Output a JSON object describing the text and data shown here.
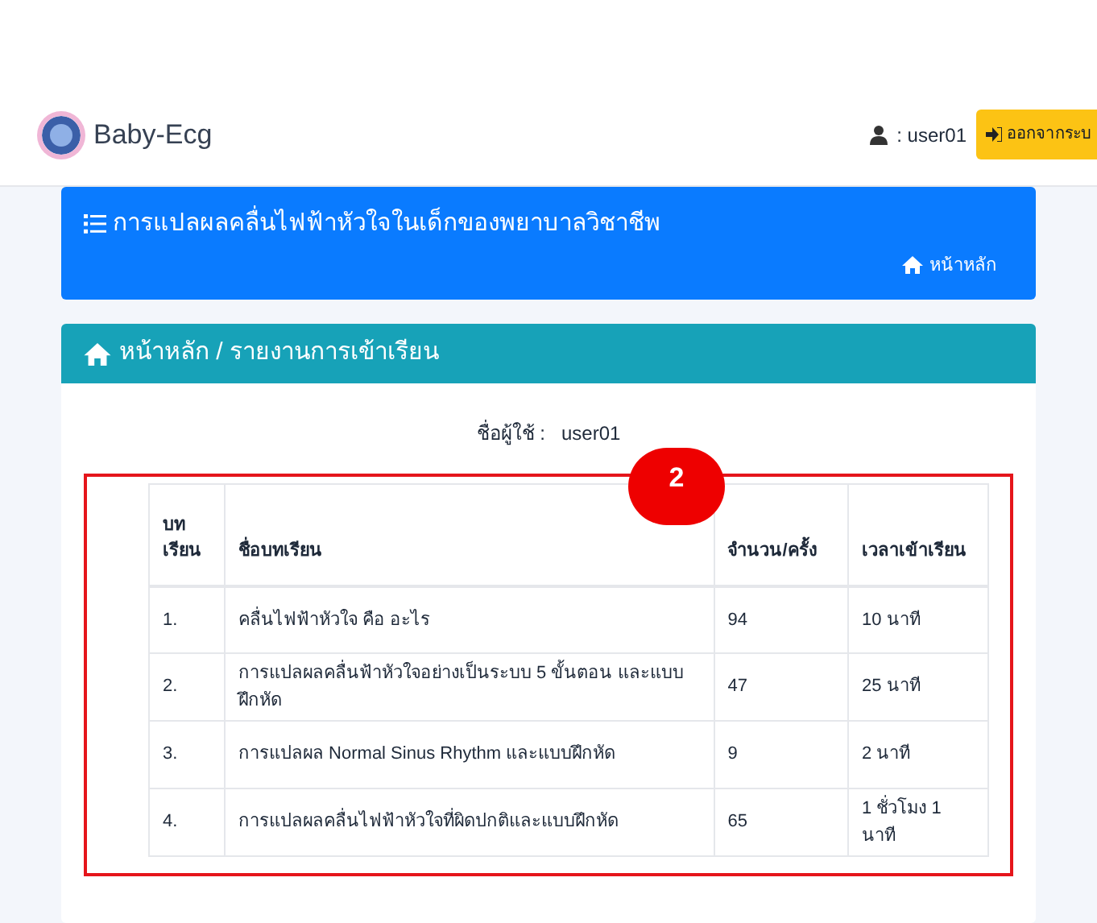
{
  "navbar": {
    "brand": "Baby-Ecg",
    "user": ": user01",
    "logout": "ออกจากระบ"
  },
  "banner": {
    "title": "การแปลผลคลื่นไฟฟ้าหัวใจในเด็กของพยาบาลวิชาชีพ",
    "home_link": "หน้าหลัก"
  },
  "report": {
    "breadcrumb": "หน้าหลัก / รายงานการเข้าเรียน",
    "username_label": "ชื่อผู้ใช้ :",
    "username": "user01",
    "annotation": "2",
    "table": {
      "columns": [
        "บท เรียน",
        "ชื่อบทเรียน",
        "จำนวน/ครั้ง",
        "เวลาเข้าเรียน"
      ],
      "rows": [
        [
          "1.",
          "คลื่นไฟฟ้าหัวใจ คือ อะไร",
          "94",
          "10 นาที"
        ],
        [
          "2.",
          "การแปลผลคลื่นฟ้าหัวใจอย่างเป็นระบบ 5 ขั้นตอน และแบบฝึกหัด",
          "47",
          "25 นาที"
        ],
        [
          "3.",
          "การแปลผล Normal Sinus Rhythm และแบบฝึกหัด",
          "9",
          "2 นาที"
        ],
        [
          "4.",
          "การแปลผลคลื่นไฟฟ้าหัวใจที่ผิดปกติและแบบฝึกหัด",
          "65",
          "1 ชั่วโมง 1 นาที"
        ]
      ]
    }
  }
}
